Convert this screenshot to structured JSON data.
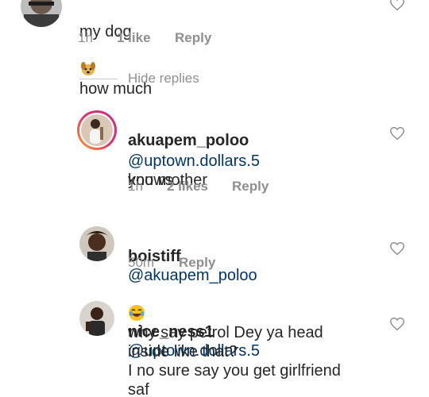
{
  "comments": [
    {
      "text_line": "my dog",
      "text_tail": "how much",
      "emoji_name": "dog-emoji",
      "time": "1h",
      "likes": "1 like",
      "reply": "Reply"
    },
    {
      "username": "akuapem_poloo",
      "mention": "@uptown.dollars.5",
      "text": "you mother",
      "text2": "knows",
      "time": "1h",
      "likes": "2 likes",
      "reply": "Reply"
    },
    {
      "username": "boistiff",
      "mention": "@akuapem_poloo",
      "emoji_name": "laughing-emoji",
      "time": "50m",
      "reply": "Reply"
    },
    {
      "username": "nice_ness1",
      "mention": "@uptown.dollars.5",
      "lines": [
        "why say petrol Dey ya head",
        "inside like that?",
        "I no sure say you get girlfriend",
        "saf"
      ]
    }
  ],
  "hide_replies": "Hide replies",
  "colors": {
    "text": "#262626",
    "muted": "#8e8e8e",
    "mention": "#003569",
    "divider": "#c7c7c7"
  }
}
